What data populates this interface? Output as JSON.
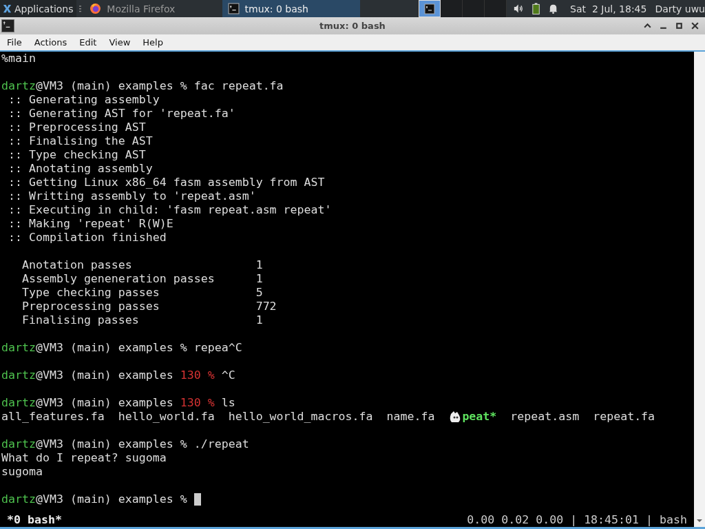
{
  "panel": {
    "apps_label": "Applications",
    "tasks": [
      {
        "title": "Mozilla Firefox",
        "selected": false
      },
      {
        "title": "tmux: 0 bash",
        "selected": true
      }
    ],
    "workspaces": [
      {
        "selected": true
      },
      {
        "selected": false
      },
      {
        "selected": false
      },
      {
        "selected": false
      }
    ],
    "clock": "Sat  2 Jul, 18:45",
    "user": "Darty uwu"
  },
  "window": {
    "title": "tmux: 0 bash"
  },
  "menu": [
    "File",
    "Actions",
    "Edit",
    "View",
    "Help"
  ],
  "terminal": {
    "lines": [
      {
        "kind": "text",
        "segments": [
          {
            "kind": "plain",
            "text": "%main"
          }
        ]
      },
      {
        "kind": "blank"
      },
      {
        "kind": "text",
        "segments": [
          {
            "kind": "user",
            "text": "dartz"
          },
          {
            "kind": "plain",
            "text": "@VM3 (main) examples % fac repeat.fa"
          }
        ]
      },
      {
        "kind": "text",
        "segments": [
          {
            "kind": "plain",
            "text": " :: Generating assembly"
          }
        ]
      },
      {
        "kind": "text",
        "segments": [
          {
            "kind": "plain",
            "text": " :: Generating AST for 'repeat.fa'"
          }
        ]
      },
      {
        "kind": "text",
        "segments": [
          {
            "kind": "plain",
            "text": " :: Preprocessing AST"
          }
        ]
      },
      {
        "kind": "text",
        "segments": [
          {
            "kind": "plain",
            "text": " :: Finalising the AST"
          }
        ]
      },
      {
        "kind": "text",
        "segments": [
          {
            "kind": "plain",
            "text": " :: Type checking AST"
          }
        ]
      },
      {
        "kind": "text",
        "segments": [
          {
            "kind": "plain",
            "text": " :: Anotating assembly"
          }
        ]
      },
      {
        "kind": "text",
        "segments": [
          {
            "kind": "plain",
            "text": " :: Getting Linux x86_64 fasm assembly from AST"
          }
        ]
      },
      {
        "kind": "text",
        "segments": [
          {
            "kind": "plain",
            "text": " :: Writting assembly to 'repeat.asm'"
          }
        ]
      },
      {
        "kind": "text",
        "segments": [
          {
            "kind": "plain",
            "text": " :: Executing in child: 'fasm repeat.asm repeat'"
          }
        ]
      },
      {
        "kind": "text",
        "segments": [
          {
            "kind": "plain",
            "text": " :: Making 'repeat' R(W)E"
          }
        ]
      },
      {
        "kind": "text",
        "segments": [
          {
            "kind": "plain",
            "text": " :: Compilation finished"
          }
        ]
      },
      {
        "kind": "blank"
      },
      {
        "kind": "text",
        "segments": [
          {
            "kind": "plain",
            "text": "   Anotation passes                  1"
          }
        ]
      },
      {
        "kind": "text",
        "segments": [
          {
            "kind": "plain",
            "text": "   Assembly geneneration passes      1"
          }
        ]
      },
      {
        "kind": "text",
        "segments": [
          {
            "kind": "plain",
            "text": "   Type checking passes              5"
          }
        ]
      },
      {
        "kind": "text",
        "segments": [
          {
            "kind": "plain",
            "text": "   Preprocessing passes              772"
          }
        ]
      },
      {
        "kind": "text",
        "segments": [
          {
            "kind": "plain",
            "text": "   Finalising passes                 1"
          }
        ]
      },
      {
        "kind": "blank"
      },
      {
        "kind": "text",
        "segments": [
          {
            "kind": "user",
            "text": "dartz"
          },
          {
            "kind": "plain",
            "text": "@VM3 (main) examples % repea^C"
          }
        ]
      },
      {
        "kind": "blank"
      },
      {
        "kind": "text",
        "segments": [
          {
            "kind": "user",
            "text": "dartz"
          },
          {
            "kind": "plain",
            "text": "@VM3 (main) examples "
          },
          {
            "kind": "error",
            "text": "130 %"
          },
          {
            "kind": "plain",
            "text": " ^C"
          }
        ]
      },
      {
        "kind": "blank"
      },
      {
        "kind": "text",
        "segments": [
          {
            "kind": "user",
            "text": "dartz"
          },
          {
            "kind": "plain",
            "text": "@VM3 (main) examples "
          },
          {
            "kind": "error",
            "text": "130 %"
          },
          {
            "kind": "plain",
            "text": " ls"
          }
        ]
      },
      {
        "kind": "text",
        "segments": [
          {
            "kind": "plain",
            "text": "all_features.fa  hello_world.fa  hello_world_macros.fa  name.fa  "
          },
          {
            "kind": "pointer"
          },
          {
            "kind": "exec",
            "text": "peat*"
          },
          {
            "kind": "plain",
            "text": "  repeat.asm  repeat.fa"
          }
        ]
      },
      {
        "kind": "blank"
      },
      {
        "kind": "text",
        "segments": [
          {
            "kind": "user",
            "text": "dartz"
          },
          {
            "kind": "plain",
            "text": "@VM3 (main) examples % ./repeat"
          }
        ]
      },
      {
        "kind": "text",
        "segments": [
          {
            "kind": "plain",
            "text": "What do I repeat? sugoma"
          }
        ]
      },
      {
        "kind": "text",
        "segments": [
          {
            "kind": "plain",
            "text": "sugoma"
          }
        ]
      },
      {
        "kind": "blank"
      },
      {
        "kind": "text",
        "segments": [
          {
            "kind": "user",
            "text": "dartz"
          },
          {
            "kind": "plain",
            "text": "@VM3 (main) examples % "
          },
          {
            "kind": "cursor"
          }
        ]
      }
    ]
  },
  "status_bar": {
    "left": "*0 bash*",
    "right": "0.00 0.02 0.00 | 18:45:01 | bash"
  }
}
